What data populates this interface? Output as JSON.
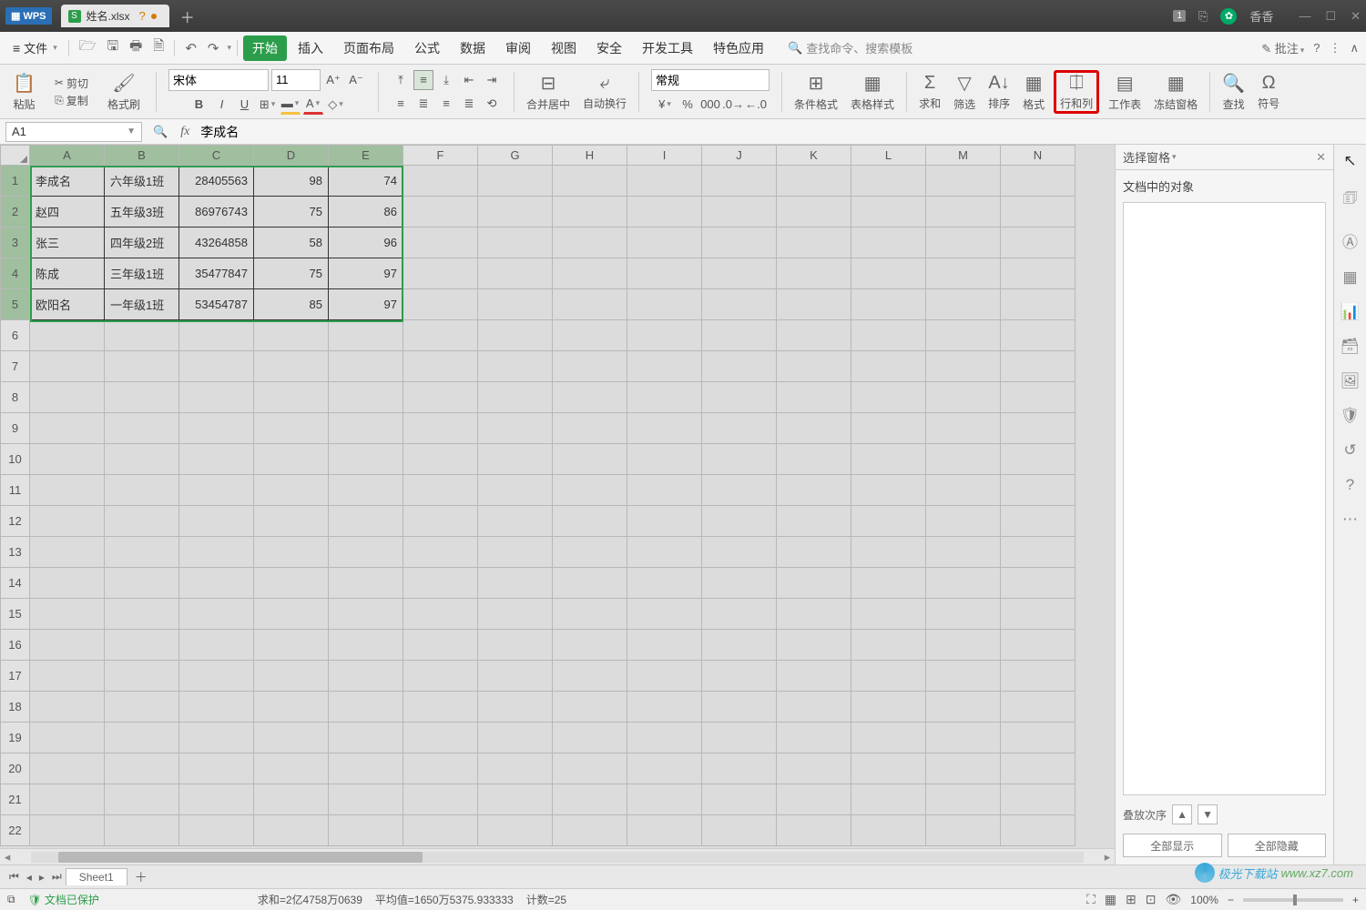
{
  "title": {
    "app": "WPS",
    "filename": "姓名.xlsx",
    "unsaved_indicator": "?"
  },
  "user": {
    "name": "香香"
  },
  "window_controls": {
    "min": "—",
    "max": "☐",
    "close": "✕"
  },
  "menubar": {
    "file_label": "文件",
    "items": [
      "开始",
      "插入",
      "页面布局",
      "公式",
      "数据",
      "审阅",
      "视图",
      "安全",
      "开发工具",
      "特色应用"
    ],
    "active_index": 0,
    "search_placeholder": "查找命令、搜索模板",
    "annotate_label": "批注"
  },
  "ribbon": {
    "clipboard": {
      "paste": "粘贴",
      "cut": "剪切",
      "copy": "复制",
      "painter": "格式刷"
    },
    "font": {
      "name": "宋体",
      "size": "11"
    },
    "merge": "合并居中",
    "wrap": "自动换行",
    "number_format": "常规",
    "cond_fmt": "条件格式",
    "table_style": "表格样式",
    "sum": "求和",
    "filter": "筛选",
    "sort": "排序",
    "format": "格式",
    "row_col": "行和列",
    "worksheet": "工作表",
    "freeze": "冻结窗格",
    "find": "查找",
    "symbol": "符号"
  },
  "formula_bar": {
    "cell_ref": "A1",
    "formula": "李成名"
  },
  "grid": {
    "columns": [
      "A",
      "B",
      "C",
      "D",
      "E",
      "F",
      "G",
      "H",
      "I",
      "J",
      "K",
      "L",
      "M",
      "N"
    ],
    "row_count": 22,
    "selected_range": {
      "r1": 1,
      "c1": 1,
      "r2": 5,
      "c2": 5
    },
    "data": [
      [
        "李成名",
        "六年级1班",
        "28405563",
        "98",
        "74"
      ],
      [
        "赵四",
        "五年级3班",
        "86976743",
        "75",
        "86"
      ],
      [
        "张三",
        "四年级2班",
        "43264858",
        "58",
        "96"
      ],
      [
        "陈成",
        "三年级1班",
        "35477847",
        "75",
        "97"
      ],
      [
        "欧阳名",
        "一年级1班",
        "53454787",
        "85",
        "97"
      ]
    ],
    "active_sheet": "Sheet1"
  },
  "side_panel": {
    "title": "选择窗格",
    "subtitle": "文档中的对象",
    "stack_label": "叠放次序",
    "show_all": "全部显示",
    "hide_all": "全部隐藏"
  },
  "statusbar": {
    "protected": "文档已保护",
    "sum_label": "求和=2亿4758万0639",
    "avg_label": "平均值=1650万5375.933333",
    "count_label": "计数=25",
    "zoom": "100%"
  },
  "watermark": {
    "text": "极光下载站",
    "url": "www.xz7.com"
  }
}
